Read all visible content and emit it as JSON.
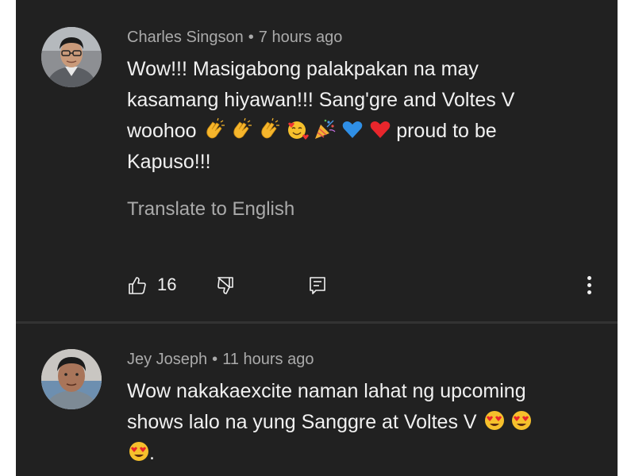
{
  "comments": [
    {
      "author": "Charles Singson",
      "separator": "•",
      "time": "7 hours ago",
      "text_line1": "Wow!!! Masigabong palakpakan na may",
      "text_line2": "kasamang hiyawan!!! Sang'gre and Voltes V",
      "text_line3_start": "woohoo",
      "text_line3_end": "proud to be",
      "text_line4": "Kapuso!!!",
      "emojis": [
        "clapping-hands",
        "clapping-hands",
        "clapping-hands",
        "smiling-face-with-hearts",
        "party-popper",
        "blue-heart",
        "red-heart"
      ],
      "translate_label": "Translate to English",
      "like_count": "16"
    },
    {
      "author": "Jey Joseph",
      "separator": "•",
      "time": "11 hours ago",
      "text_line1": "Wow nakakaexcite naman lahat ng upcoming",
      "text_line2": "shows lalo na yung Sanggre at Voltes V",
      "text_line3_end": ".",
      "emojis": [
        "heart-eyes",
        "heart-eyes",
        "heart-eyes"
      ]
    }
  ],
  "colors": {
    "background": "#212121",
    "primary_text": "#f1f1f1",
    "secondary_text": "#aaaaaa",
    "divider": "#333333"
  },
  "icons": [
    "thumbs-up-icon",
    "thumbs-down-icon",
    "reply-icon",
    "more-options-icon"
  ]
}
